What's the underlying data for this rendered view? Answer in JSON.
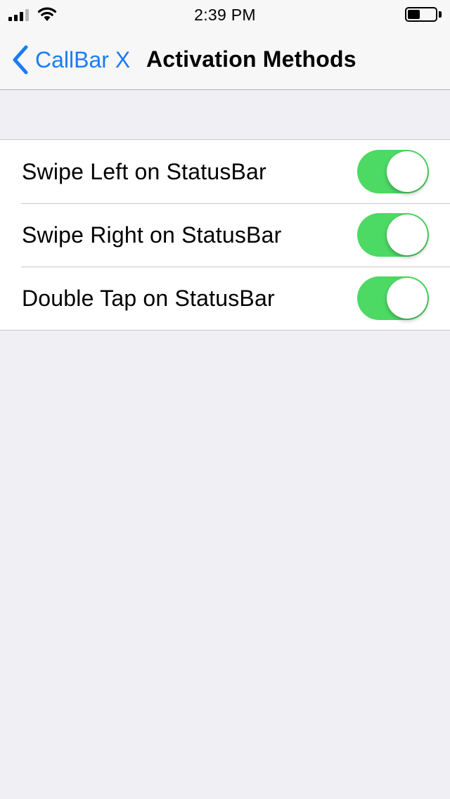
{
  "status_bar": {
    "time": "2:39 PM",
    "signal_bars_filled": 3,
    "signal_bars_total": 4,
    "battery_level": 0.45
  },
  "nav": {
    "back_label": "CallBar X",
    "title": "Activation Methods",
    "accent_color": "#1a7cf5"
  },
  "settings": {
    "toggle_on_color": "#4cd964",
    "items": [
      {
        "label": "Swipe Left on StatusBar",
        "on": true
      },
      {
        "label": "Swipe Right on StatusBar",
        "on": true
      },
      {
        "label": "Double Tap on StatusBar",
        "on": true
      }
    ]
  }
}
